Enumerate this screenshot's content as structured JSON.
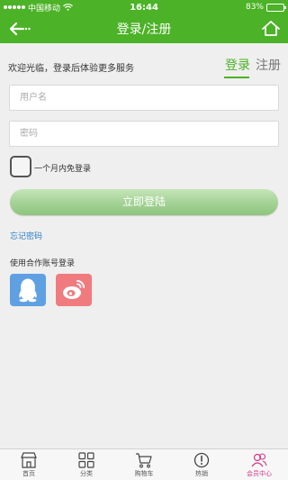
{
  "status_bar": {
    "carrier": "中国移动",
    "time": "16:44",
    "battery": "83%",
    "battery_level": 0.83
  },
  "nav": {
    "title": "登录/注册",
    "back_icon": "back-arrow-icon",
    "home_icon": "home-icon"
  },
  "login": {
    "welcome": "欢迎光临，登录后体验更多服务",
    "tab_login": "登录",
    "tab_register": "注册",
    "username_placeholder": "用户名",
    "password_placeholder": "密码",
    "remember_label": "一个月内免登录",
    "submit_label": "立即登陆",
    "forgot_label": "忘记密码",
    "partner_title": "使用合作账号登录"
  },
  "colors": {
    "brand": "#4cb227",
    "link": "#2a7fc7",
    "qq": "#5fa0e3",
    "weibo": "#ef7b7e",
    "active_tab": "#d4378b"
  },
  "tabbar": {
    "items": [
      {
        "label": "首页",
        "icon": "store-icon"
      },
      {
        "label": "分类",
        "icon": "grid-icon"
      },
      {
        "label": "购物车",
        "icon": "cart-icon"
      },
      {
        "label": "热销",
        "icon": "alert-circle-icon"
      },
      {
        "label": "会员中心",
        "icon": "members-icon"
      }
    ],
    "active_index": 4
  }
}
